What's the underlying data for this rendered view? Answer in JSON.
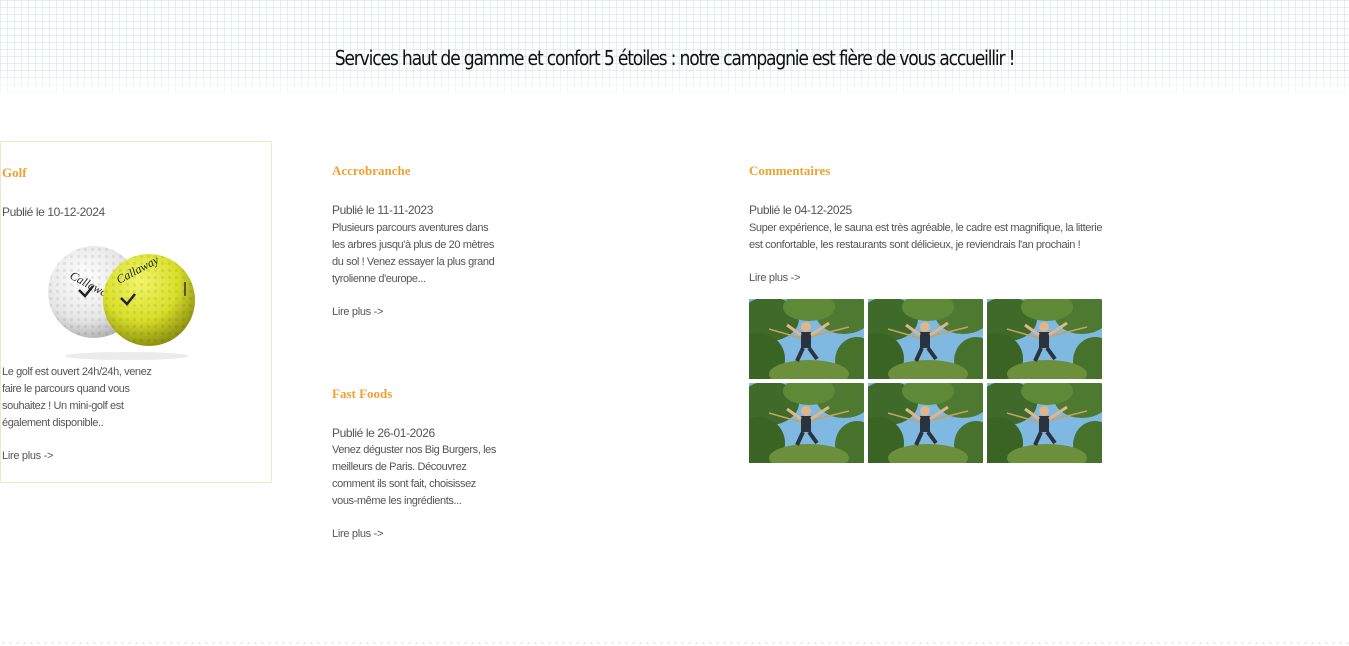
{
  "header": {
    "tagline": "Services haut de gamme et confort 5 étoiles : notre campagnie est fière de vous accueillir !"
  },
  "articles": [
    {
      "title": "Golf",
      "date": "Publié le 10-12-2024",
      "text_lines": [
        "Le golf est ouvert 24h/24h, venez",
        "faire le parcours quand vous",
        "souhaitez ! Un mini-golf est",
        "également disponible.."
      ],
      "read_more": "Lire plus ->",
      "image": "golf-balls-image"
    },
    {
      "title": "Accrobranche",
      "date": "Publié le 11-11-2023",
      "text_lines": [
        "Plusieurs parcours aventures dans",
        "les arbres jusqu'à plus de 20 mètres",
        "du sol ! Venez essayer la plus grand",
        "tyrolienne d'europe..."
      ],
      "read_more": "Lire plus ->"
    },
    {
      "title": "Fast Foods",
      "date": "Publié le 26-01-2026",
      "text_lines": [
        "Venez déguster nos Big Burgers, les",
        "meilleurs de Paris. Découvrez",
        "comment ils sont fait, choisissez",
        "vous-même les ingrédients..."
      ],
      "read_more": "Lire plus ->"
    },
    {
      "title": "Commentaires",
      "date": "Publié le 04-12-2025",
      "text_lines": [
        "Super expérience, le sauna est très agréable, le cadre est magnifique, la litterie",
        "est confortable, les restaurants sont délicieux, je reviendrais l'an prochain !"
      ],
      "read_more": "Lire plus ->",
      "gallery_count": 6
    }
  ],
  "colors": {
    "title_accent": "#f0a030",
    "body_text": "#555555",
    "card_border": "#f0e6c8"
  }
}
